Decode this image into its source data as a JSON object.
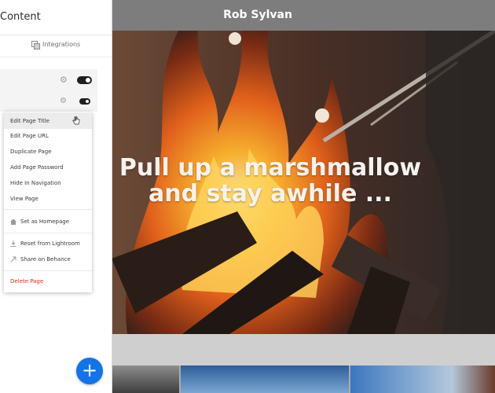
{
  "panel": {
    "title": "Content",
    "integrations_label": "Integrations"
  },
  "context_menu": {
    "items": [
      {
        "label": "Edit Page Title"
      },
      {
        "label": "Edit Page URL"
      },
      {
        "label": "Duplicate Page"
      },
      {
        "label": "Add Page Password"
      },
      {
        "label": "Hide In Navigation"
      },
      {
        "label": "View Page"
      },
      {
        "label": "Set as Homepage",
        "icon": "home-icon"
      },
      {
        "label": "Reset from Lightroom",
        "icon": "download-icon"
      },
      {
        "label": "Share on Behance",
        "icon": "share-arrow-icon"
      },
      {
        "label": "Delete Page",
        "color": "#e02b20"
      }
    ]
  },
  "add_button": {
    "glyph": "+",
    "color": "#1473e6"
  },
  "site": {
    "title": "Rob Sylvan",
    "hero_line1": "Pull up a marshmallow",
    "hero_line2": "and stay awhile ..."
  }
}
